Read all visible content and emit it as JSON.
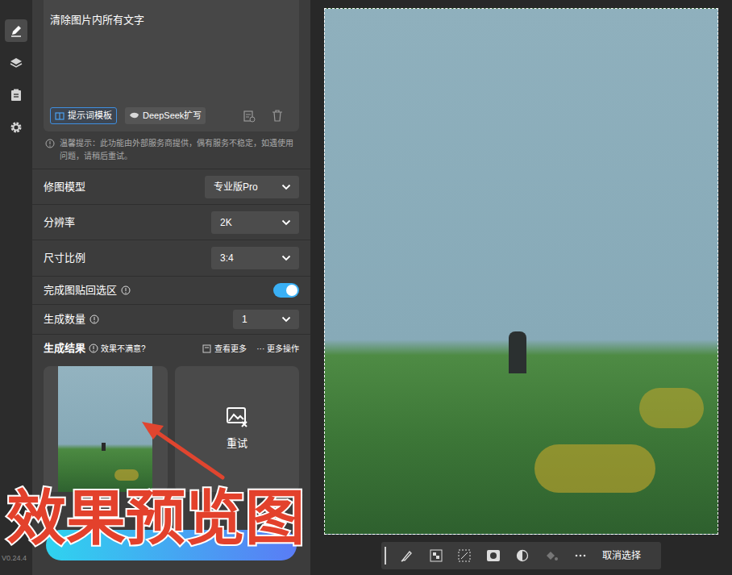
{
  "sidebar": {
    "items": [
      {
        "selected": true
      },
      {
        "selected": false
      },
      {
        "selected": false
      },
      {
        "selected": false
      }
    ],
    "version": "V0.24.4"
  },
  "prompt": {
    "text": "清除图片内所有文字",
    "buttons": [
      "提示词模板",
      "DeepSeek扩写"
    ]
  },
  "notice": "温馨提示：此功能由外部服务商提供，偶有服务不稳定，如遇使用问题，请稍后重试。",
  "settings": [
    {
      "kind": "select",
      "label": "修图模型",
      "value": "专业版Pro",
      "info": false
    },
    {
      "kind": "select",
      "label": "分辨率",
      "value": "2K",
      "info": false
    },
    {
      "kind": "select",
      "label": "尺寸比例",
      "value": "3:4",
      "info": false
    },
    {
      "kind": "toggle",
      "label": "完成图贴回选区",
      "on": true,
      "info": true
    },
    {
      "kind": "select",
      "label": "生成数量",
      "value": "1",
      "info": true
    }
  ],
  "results": {
    "title": "生成结果",
    "hint": "效果不满意?",
    "actions": [
      "查看更多",
      "··· 更多操作"
    ],
    "retry": "重试"
  },
  "annotation": "效果预览图",
  "toolbar": {
    "deselect": "取消选择"
  }
}
